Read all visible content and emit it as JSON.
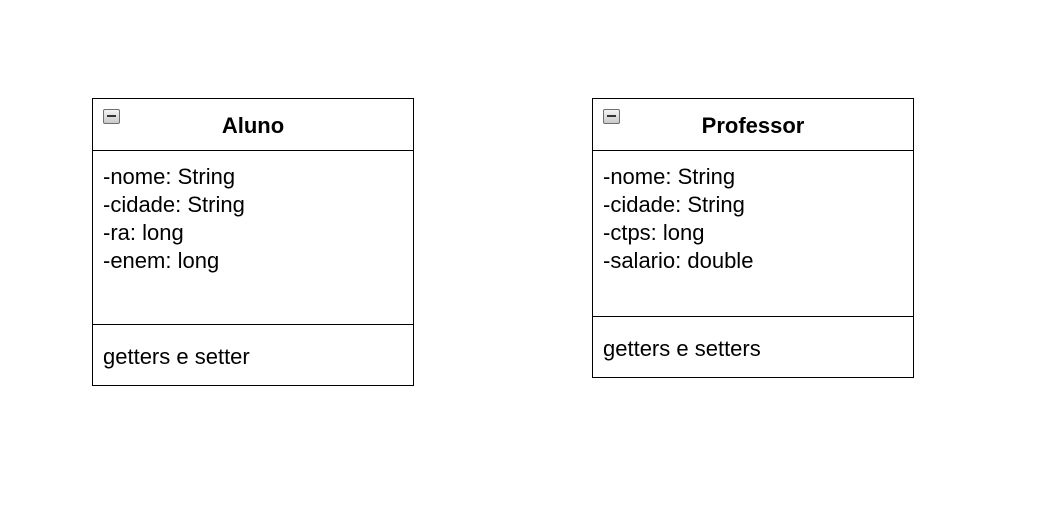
{
  "classes": [
    {
      "name": "Aluno",
      "attributes": [
        "-nome: String",
        "-cidade: String",
        "-ra: long",
        "-enem: long"
      ],
      "methods": [
        "getters e setter"
      ]
    },
    {
      "name": "Professor",
      "attributes": [
        "-nome: String",
        "-cidade: String",
        "-ctps: long",
        "-salario: double"
      ],
      "methods": [
        "getters e setters"
      ]
    }
  ],
  "icons": {
    "collapse": "collapse-minus-icon"
  },
  "colors": {
    "background": "#ffffff",
    "border": "#000000",
    "text": "#000000"
  }
}
